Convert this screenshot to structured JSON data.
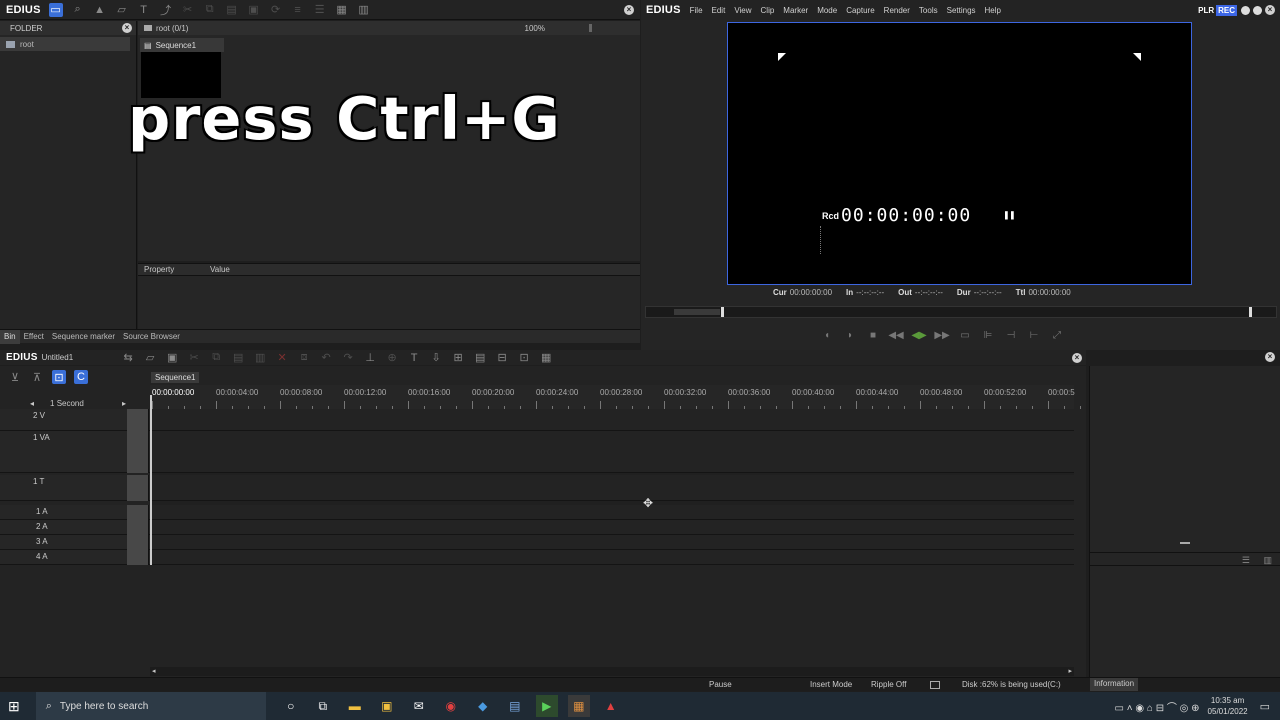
{
  "bin": {
    "app_name": "EDIUS",
    "folder_header": "FOLDER",
    "folder_root": "root",
    "path": "root (0/1)",
    "zoom": "100%",
    "clip_name": "Sequence1",
    "property_col": "Property",
    "value_col": "Value",
    "tabs": [
      "Bin",
      "Effect",
      "Sequence marker",
      "Source Browser"
    ]
  },
  "overlay": {
    "caption": "press Ctrl+G"
  },
  "player": {
    "app_name": "EDIUS",
    "menus": [
      "File",
      "Edit",
      "View",
      "Clip",
      "Marker",
      "Mode",
      "Capture",
      "Render",
      "Tools",
      "Settings",
      "Help"
    ],
    "mode_label": "PLR",
    "rec_label": "REC",
    "rcd_label": "Rcd",
    "timecode": "00:00:00:00",
    "info": {
      "cur_label": "Cur",
      "cur": "00:00:00:00",
      "in_label": "In",
      "in": "--:--:--:--",
      "out_label": "Out",
      "out": "--:--:--:--",
      "dur_label": "Dur",
      "dur": "--:--:--:--",
      "ttl_label": "Ttl",
      "ttl": "00:00:00:00"
    }
  },
  "timeline": {
    "app_name": "EDIUS",
    "project": "Untitled1",
    "sequence_tab": "Sequence1",
    "scale": "1 Second",
    "ruler": [
      "00:00:00:00",
      "00:00:04:00",
      "00:00:08:00",
      "00:00:12:00",
      "00:00:16:00",
      "00:00:20:00",
      "00:00:24:00",
      "00:00:28:00",
      "00:00:32:00",
      "00:00:36:00",
      "00:00:40:00",
      "00:00:44:00",
      "00:00:48:00",
      "00:00:52:00",
      "00:00:5"
    ],
    "tracks": [
      "2 V",
      "1 VA",
      "1 T",
      "1 A",
      "2 A",
      "3 A",
      "4 A"
    ]
  },
  "status": {
    "pause": "Pause",
    "insert_mode": "Insert Mode",
    "ripple": "Ripple Off",
    "disk": "Disk :62% is being used(C:)",
    "info_tab": "Information"
  },
  "taskbar": {
    "search_placeholder": "Type here to search",
    "time": "10:35 am",
    "date": "05/01/2022"
  },
  "colors": {
    "accent": "#3a6fd8",
    "rec": "#3c66e6"
  }
}
